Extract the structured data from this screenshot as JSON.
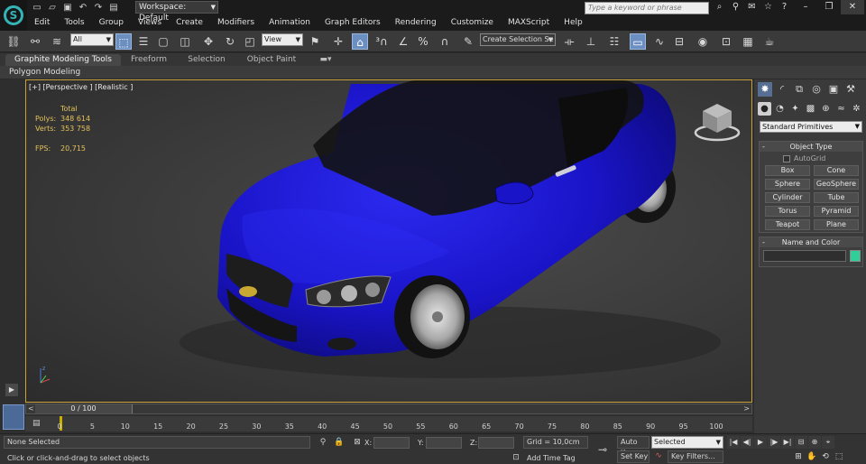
{
  "app": {
    "logo_glyph": "S",
    "workspace": "Workspace: Default",
    "search_placeholder": "Type a keyword or phrase",
    "quick_access_icons": [
      "new-icon",
      "open-icon",
      "save-icon",
      "undo-icon",
      "redo-icon",
      "project-icon"
    ]
  },
  "menu": [
    "Edit",
    "Tools",
    "Group",
    "Views",
    "Create",
    "Modifiers",
    "Animation",
    "Graph Editors",
    "Rendering",
    "Customize",
    "MAXScript",
    "Help"
  ],
  "toolbar": {
    "selection_filter": "All",
    "ref_coord": "View",
    "named_selection": "Create Selection Se"
  },
  "ribbon": {
    "tabs": [
      "Graphite Modeling Tools",
      "Freeform",
      "Selection",
      "Object Paint"
    ],
    "active_tab": "Graphite Modeling Tools",
    "panel": "Polygon Modeling"
  },
  "viewport": {
    "label": "[+] [Perspective ] [Realistic ]",
    "stats_header": "Total",
    "polys_label": "Polys:",
    "polys_value": "348 614",
    "verts_label": "Verts:",
    "verts_value": "353 758",
    "fps_label": "FPS:",
    "fps_value": "20,715",
    "car_color": "#1a14c8",
    "selection_border": "#c9a23c"
  },
  "command_panel": {
    "primitive_type": "Standard Primitives",
    "object_type_title": "Object Type",
    "autogrid": "AutoGrid",
    "buttons": [
      "Box",
      "Cone",
      "Sphere",
      "GeoSphere",
      "Cylinder",
      "Tube",
      "Torus",
      "Pyramid",
      "Teapot",
      "Plane"
    ],
    "name_color_title": "Name and Color",
    "swatch_color": "#2fcf9a"
  },
  "timeline": {
    "frame_display": "0 / 100",
    "ticks": [
      "0",
      "5",
      "10",
      "15",
      "20",
      "25",
      "30",
      "35",
      "40",
      "45",
      "50",
      "55",
      "60",
      "65",
      "70",
      "75",
      "80",
      "85",
      "90",
      "95",
      "100"
    ]
  },
  "status": {
    "selection": "None Selected",
    "prompt": "Click or click-and-drag to select objects",
    "x_label": "X:",
    "y_label": "Y:",
    "z_label": "Z:",
    "grid": "Grid = 10,0cm",
    "add_time_tag": "Add Time Tag",
    "auto_key": "Auto Key",
    "set_key": "Set Key",
    "key_mode": "Selected",
    "key_filters": "Key Filters..."
  }
}
